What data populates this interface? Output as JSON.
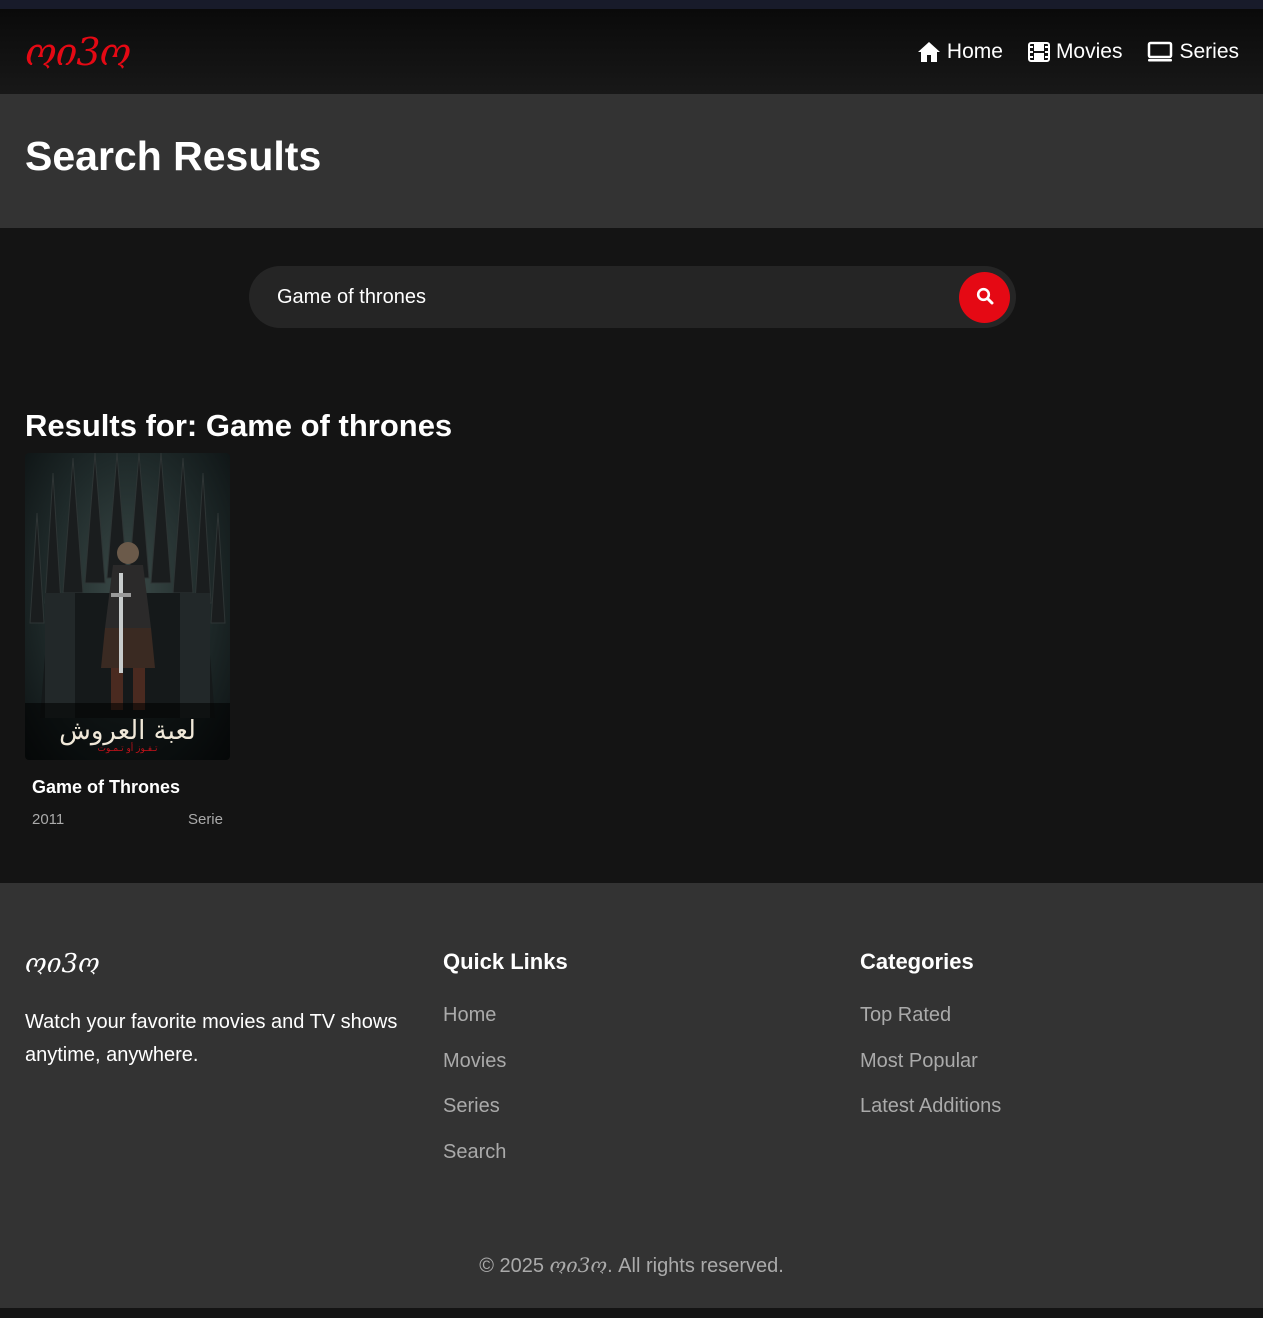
{
  "brand": {
    "logo": "ოი3ო",
    "color": "#e50914"
  },
  "nav": {
    "items": [
      {
        "label": "Home",
        "icon": "home-icon"
      },
      {
        "label": "Movies",
        "icon": "film-icon"
      },
      {
        "label": "Series",
        "icon": "tv-icon"
      }
    ]
  },
  "hero": {
    "title": "Search Results"
  },
  "search": {
    "value": "Game of thrones",
    "icon": "search-icon"
  },
  "results": {
    "heading": "Results for: Game of thrones",
    "items": [
      {
        "title": "Game of Thrones",
        "year": "2011",
        "type": "Serie",
        "poster_text": "لعبة العروش",
        "poster_subtext": "تـفـوز أو تـمـوت"
      }
    ]
  },
  "footer": {
    "logo": "ოი3ო",
    "description": "Watch your favorite movies and TV shows anytime, anywhere.",
    "quick_links": {
      "title": "Quick Links",
      "items": [
        "Home",
        "Movies",
        "Series",
        "Search"
      ]
    },
    "categories": {
      "title": "Categories",
      "items": [
        "Top Rated",
        "Most Popular",
        "Latest Additions"
      ]
    },
    "copyright_prefix": "© 2025",
    "copyright_brand": "ოი3ო",
    "copyright_suffix": ". All rights reserved."
  }
}
